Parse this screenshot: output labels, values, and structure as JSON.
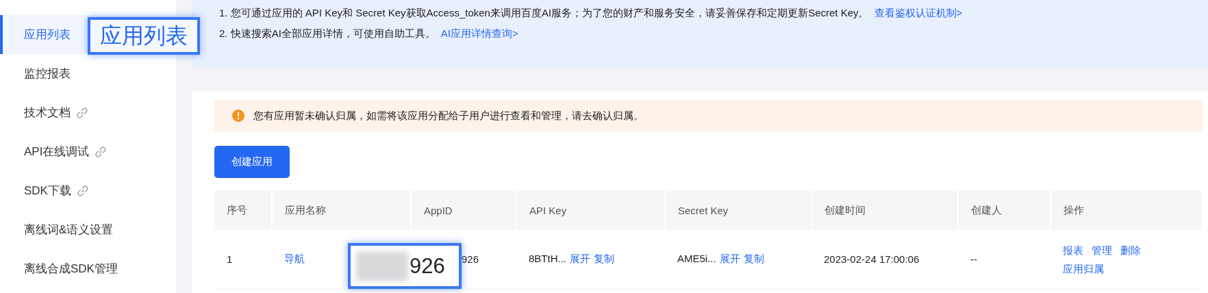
{
  "sidebar": {
    "items": [
      {
        "label": "应用列表",
        "selected": true,
        "external": false
      },
      {
        "label": "监控报表",
        "selected": false,
        "external": false
      },
      {
        "label": "技术文档",
        "selected": false,
        "external": true
      },
      {
        "label": "API在线调试",
        "selected": false,
        "external": true
      },
      {
        "label": "SDK下载",
        "selected": false,
        "external": true
      },
      {
        "label": "离线词&语义设置",
        "selected": false,
        "external": false
      },
      {
        "label": "离线合成SDK管理",
        "selected": false,
        "external": false
      }
    ]
  },
  "notice": {
    "lines": [
      {
        "text": "1. 您可通过应用的 API Key和 Secret Key获取Access_token来调用百度AI服务；为了您的财产和服务安全，请妥善保存和定期更新Secret Key。",
        "link": "查看鉴权认证机制>"
      },
      {
        "text": "2. 快速搜索AI全部应用详情，可使用自助工具。",
        "link": "AI应用详情查询>"
      }
    ]
  },
  "warning": {
    "text": "您有应用暂未确认归属，如需将该应用分配给子用户进行查看和管理，请去确认归属。"
  },
  "create_button": "创建应用",
  "table": {
    "columns": [
      "序号",
      "应用名称",
      "AppID",
      "API Key",
      "Secret Key",
      "创建时间",
      "创建人",
      "操作"
    ],
    "rows": [
      {
        "index": "1",
        "name": "导航",
        "app_id": "926",
        "api_key": {
          "value": "8BTtH...",
          "actions": [
            "展开",
            "复制"
          ]
        },
        "secret_key": {
          "value": "AME5i...",
          "actions": [
            "展开",
            "复制"
          ]
        },
        "created": "2023-02-24 17:00:06",
        "creator": "--",
        "operations": [
          "报表",
          "管理",
          "删除",
          "应用归属"
        ]
      }
    ]
  },
  "callouts": [
    {
      "text": "应用列表",
      "redacted": false
    },
    {
      "text": "926",
      "redacted": true
    }
  ]
}
